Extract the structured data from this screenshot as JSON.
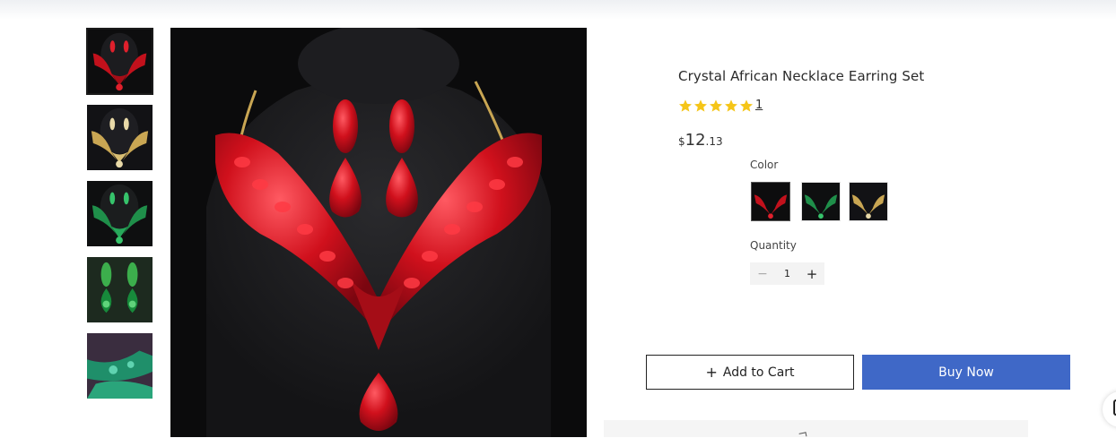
{
  "product": {
    "title": "Crystal African Necklace Earring Set",
    "rating_stars": 5,
    "review_count": "1",
    "price": {
      "currency": "$",
      "whole": "12",
      "cents": ".13"
    }
  },
  "gallery": {
    "thumbnails": [
      "red-crystal-set",
      "gold-crystal-set",
      "green-crystal-set",
      "green-crystal-earrings",
      "green-crystal-detail"
    ],
    "active_index": 0
  },
  "options": {
    "color_label": "Color",
    "swatches": [
      "red",
      "green",
      "gold"
    ],
    "selected_index": 0,
    "quantity_label": "Quantity",
    "quantity": "1",
    "minus_symbol": "−",
    "plus_symbol": "+"
  },
  "actions": {
    "add_to_cart": "Add to Cart",
    "add_to_cart_icon": "+",
    "buy_now": "Buy Now"
  },
  "colors": {
    "accent": "#3f68c7",
    "star": "#f5c518",
    "ruby": "#d0101c",
    "emerald": "#1f8f4a",
    "gold": "#c9a653"
  }
}
